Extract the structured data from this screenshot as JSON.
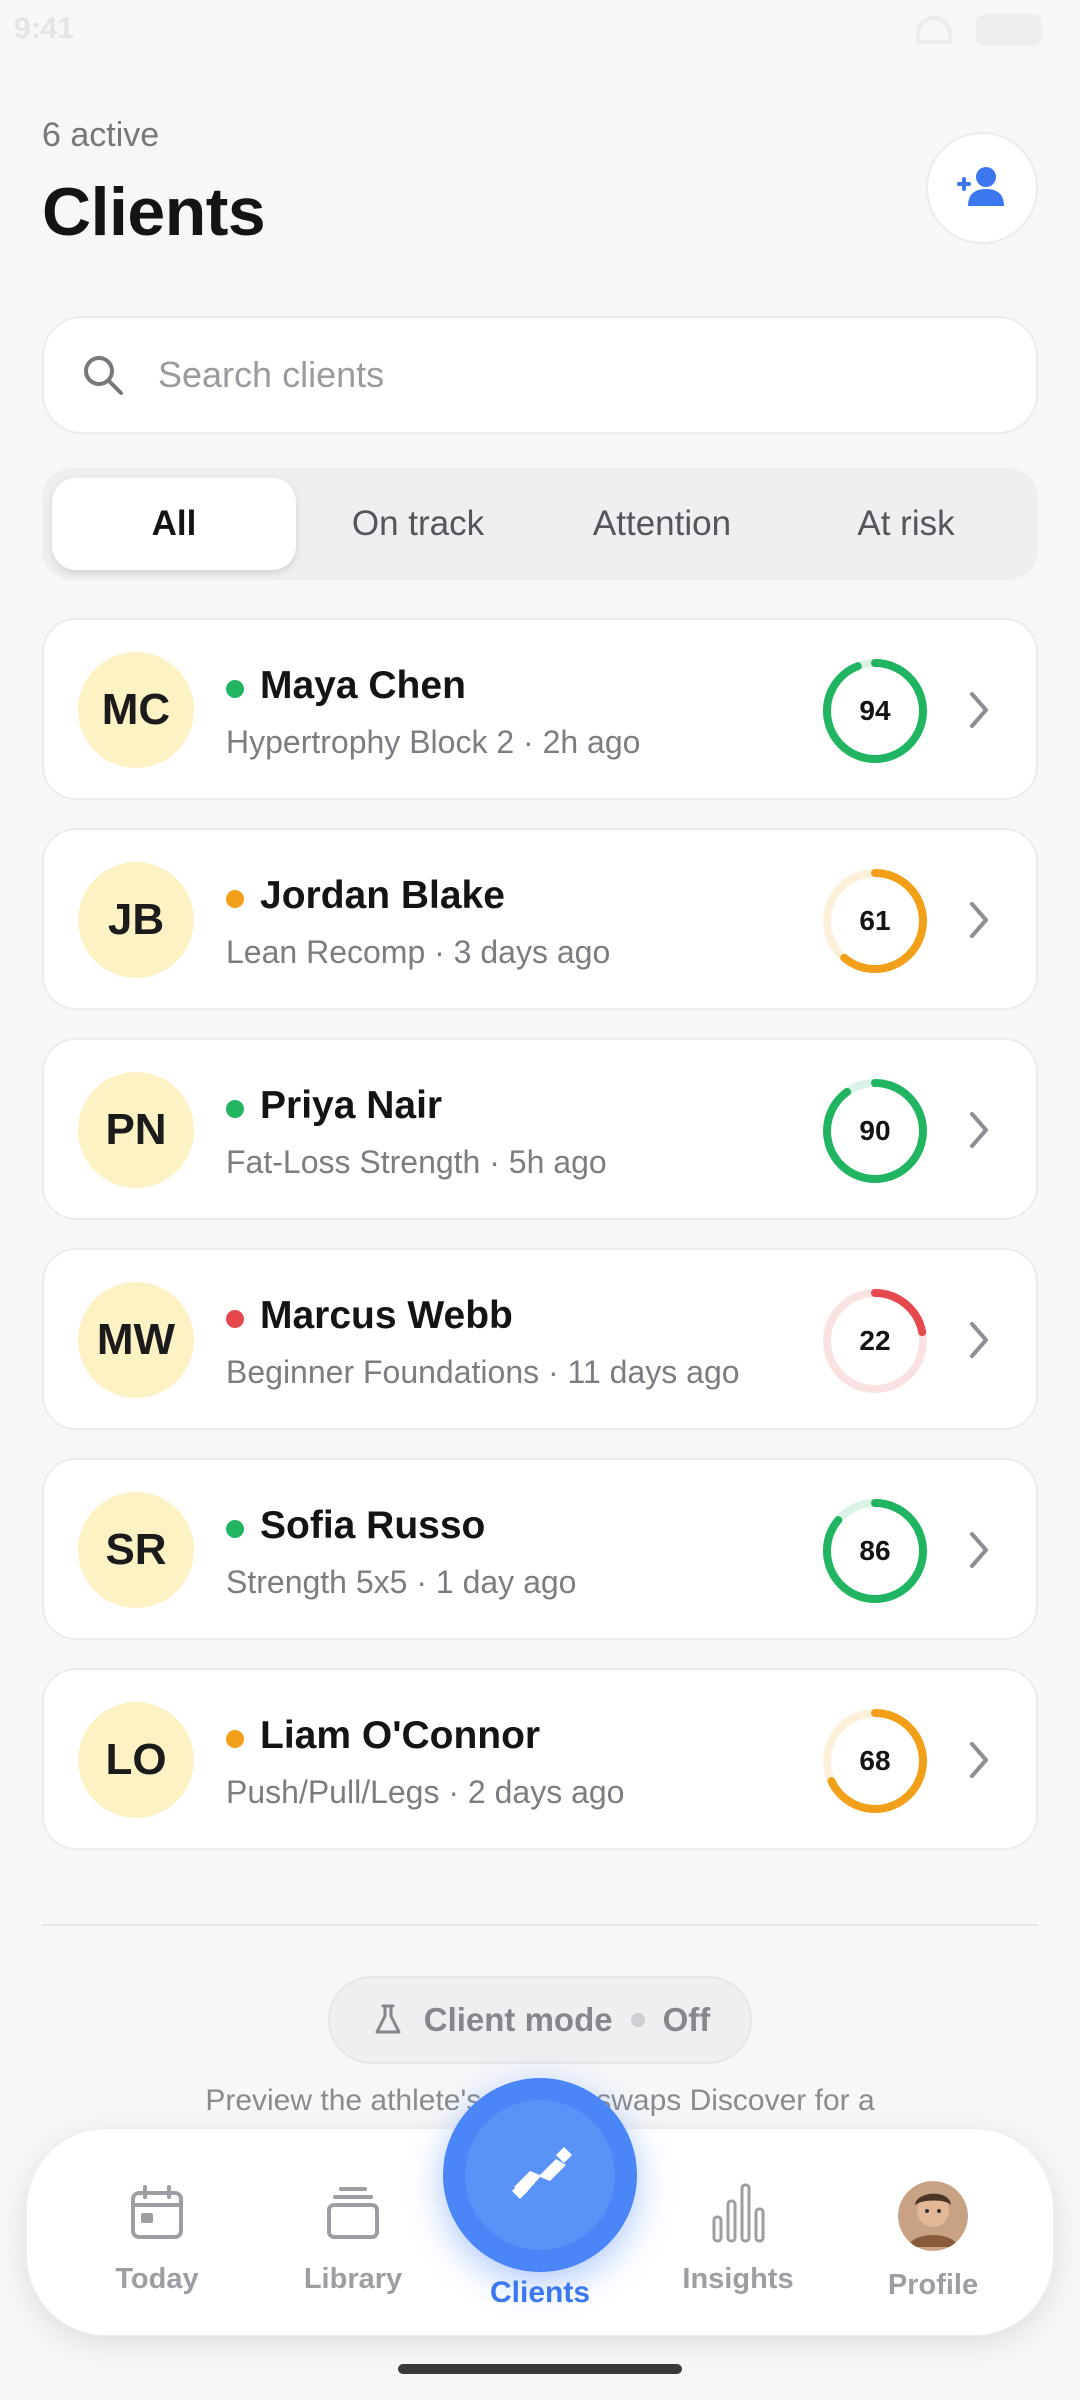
{
  "status_bar": {
    "time": "9:41"
  },
  "header": {
    "subtitle": "6 active",
    "title": "Clients",
    "add_client_icon": "add-person-icon"
  },
  "search": {
    "placeholder": "Search clients",
    "value": ""
  },
  "filters": {
    "selected": "All",
    "items": [
      {
        "label": "All"
      },
      {
        "label": "On track"
      },
      {
        "label": "Attention"
      },
      {
        "label": "At risk"
      }
    ]
  },
  "colors": {
    "accent": "#3b78ef",
    "on_track": "#22b561",
    "attention": "#f2a019",
    "at_risk": "#e5484d",
    "avatar_bg": "#fdf2c4"
  },
  "clients": [
    {
      "initials": "MC",
      "name": "Maya Chen",
      "meta": "Hypertrophy Block 2 · 2h ago",
      "score": 94,
      "status": "on_track"
    },
    {
      "initials": "JB",
      "name": "Jordan Blake",
      "meta": "Lean Recomp · 3 days ago",
      "score": 61,
      "status": "attention"
    },
    {
      "initials": "PN",
      "name": "Priya Nair",
      "meta": "Fat-Loss Strength · 5h ago",
      "score": 90,
      "status": "on_track"
    },
    {
      "initials": "MW",
      "name": "Marcus Webb",
      "meta": "Beginner Foundations · 11 days ago",
      "score": 22,
      "status": "at_risk"
    },
    {
      "initials": "SR",
      "name": "Sofia Russo",
      "meta": "Strength 5x5 · 1 day ago",
      "score": 86,
      "status": "on_track"
    },
    {
      "initials": "LO",
      "name": "Liam O'Connor",
      "meta": "Push/Pull/Legs · 2 days ago",
      "score": 68,
      "status": "attention"
    }
  ],
  "client_mode": {
    "label": "Client mode",
    "value": "Off",
    "caption": "Preview the athlete's view — swaps Discover for a"
  },
  "tabbar": {
    "today": "Today",
    "library": "Library",
    "clients": "Clients",
    "insights": "Insights",
    "profile": "Profile"
  }
}
